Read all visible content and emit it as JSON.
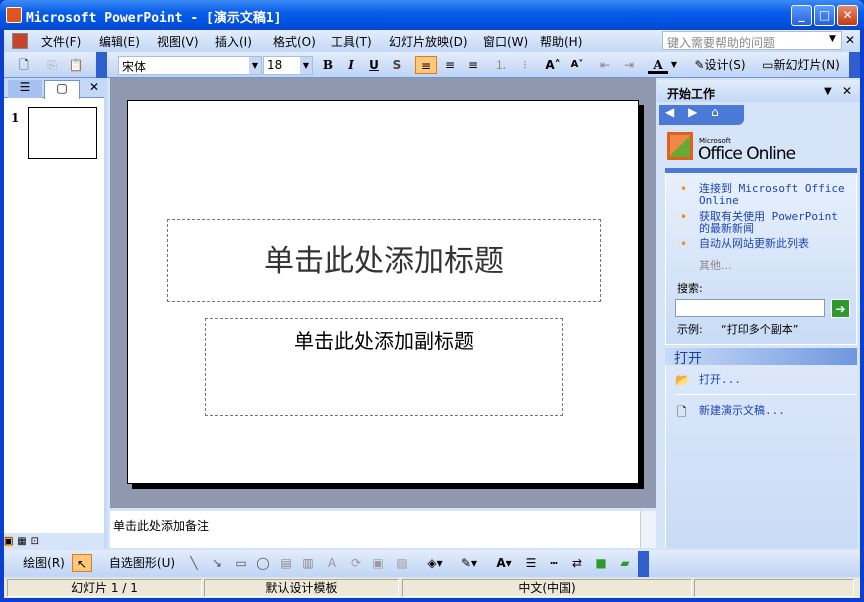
{
  "window": {
    "title": "Microsoft PowerPoint - [演示文稿1]",
    "min": "_",
    "max": "□",
    "close": "✕"
  },
  "menu": [
    "文件(F)",
    "编辑(E)",
    "视图(V)",
    "插入(I)",
    "格式(O)",
    "工具(T)",
    "幻灯片放映(D)",
    "窗口(W)",
    "帮助(H)"
  ],
  "help": {
    "placeholder": "键入需要帮助的问题",
    "close": "✕"
  },
  "toolbar": {
    "font": "宋体",
    "size": "18",
    "bold": "B",
    "italic": "I",
    "underline": "U",
    "shadow": "S",
    "grow": "A˄",
    "shrink": "A˅",
    "font_color": "A",
    "design": "设计(S)",
    "new_slide": "新幻灯片(N)"
  },
  "outline": {
    "slide_number": "1",
    "close": "✕"
  },
  "slide": {
    "title": "单击此处添加标题",
    "subtitle": "单击此处添加副标题"
  },
  "notes": "单击此处添加备注",
  "taskpane": {
    "title": "开始工作",
    "office_small": "Microsoft",
    "office": "Office Online",
    "links": [
      "连接到 Microsoft Office Online",
      "获取有关使用 PowerPoint 的最新新闻",
      "自动从网站更新此列表"
    ],
    "more": "其他...",
    "search_label": "搜索:",
    "example_label": "示例:",
    "example": "“打印多个副本”",
    "open_header": "打开",
    "open": "打开...",
    "new": "新建演示文稿..."
  },
  "drawbar": {
    "draw": "绘图(R)",
    "autoshapes": "自选图形(U)"
  },
  "status": {
    "slide": "幻灯片 1 / 1",
    "template": "默认设计模板",
    "language": "中文(中国)"
  }
}
